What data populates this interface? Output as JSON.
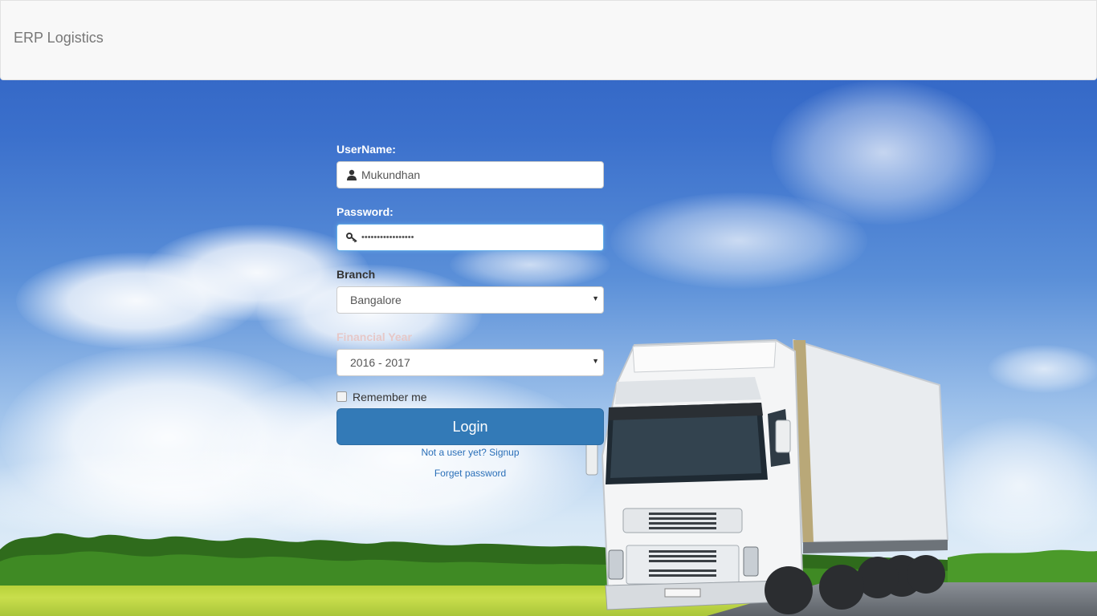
{
  "header": {
    "brand": "ERP Logistics"
  },
  "form": {
    "username_label": "UserName:",
    "username_value": "Mukundhan",
    "password_label": "Password:",
    "password_value": "•••••••••••••••••",
    "branch_label": "Branch",
    "branch_value": "Bangalore",
    "financial_year_label": "Financial Year",
    "financial_year_value": "2016 - 2017",
    "remember_label": "Remember me",
    "remember_checked": false,
    "login_label": "Login",
    "signup_link": "Not a user yet? Signup",
    "forget_link": "Forget password"
  },
  "icons": {
    "username": "user-icon",
    "password": "key-icon",
    "select_caret": "caret-down-icon"
  },
  "colors": {
    "primary": "#337ab7",
    "navbar_bg": "#f8f8f8",
    "link": "#2a6fb8"
  }
}
